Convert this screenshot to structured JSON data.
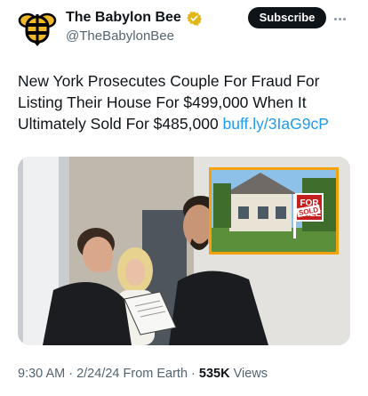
{
  "account": {
    "display_name": "The Babylon Bee",
    "handle": "@TheBabylonBee",
    "subscribe_label": "Subscribe"
  },
  "tweet": {
    "text": "New York Prosecutes Couple For Fraud For Listing Their House For $499,000 When It Ultimately Sold For $485,000 ",
    "link": "buff.ly/3IaG9cP"
  },
  "media": {
    "sign_top": "FOR",
    "sign_bottom": "SALE",
    "sign_tag": "SOLD"
  },
  "meta": {
    "time": "9:30 AM",
    "sep1": " · ",
    "date": "2/24/24",
    "source": " From Earth · ",
    "views": "535K",
    "views_label": " Views"
  },
  "colors": {
    "link": "#1d9bf0",
    "verified": "#e2b719",
    "subtle": "#536471"
  },
  "icons": [
    "bee-logo-icon",
    "verified-badge-icon",
    "more-options-icon"
  ]
}
